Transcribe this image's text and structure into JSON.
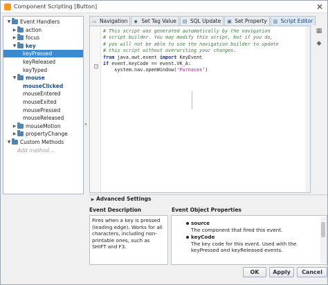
{
  "window": {
    "title": "Component Scripting [Button]"
  },
  "tree": {
    "items": [
      {
        "label": "Event Handlers",
        "level": 0,
        "expanded": true,
        "folder": true
      },
      {
        "label": "action",
        "level": 1,
        "expanded": false,
        "folder": true
      },
      {
        "label": "focus",
        "level": 1,
        "expanded": false,
        "folder": true
      },
      {
        "label": "key",
        "level": 1,
        "expanded": true,
        "folder": true,
        "bold": true
      },
      {
        "label": "keyPressed",
        "level": 2,
        "selected": true
      },
      {
        "label": "keyReleased",
        "level": 2
      },
      {
        "label": "keyTyped",
        "level": 2
      },
      {
        "label": "mouse",
        "level": 1,
        "expanded": true,
        "folder": true,
        "bold": true
      },
      {
        "label": "mouseClicked",
        "level": 2,
        "bold": true
      },
      {
        "label": "mouseEntered",
        "level": 2
      },
      {
        "label": "mouseExited",
        "level": 2
      },
      {
        "label": "mousePressed",
        "level": 2
      },
      {
        "label": "mouseReleased",
        "level": 2
      },
      {
        "label": "mouseMotion",
        "level": 1,
        "expanded": false,
        "folder": true
      },
      {
        "label": "propertyChange",
        "level": 1,
        "expanded": false,
        "folder": true
      },
      {
        "label": "Custom Methods",
        "level": 0,
        "expanded": true,
        "folder": true
      },
      {
        "label": "Add method...",
        "level": 1,
        "placeholder": true
      }
    ]
  },
  "tabs": [
    {
      "label": "Navigation",
      "icon": "navigation-icon",
      "active": false
    },
    {
      "label": "Set Tag Value",
      "icon": "tag-icon",
      "active": false
    },
    {
      "label": "SQL Update",
      "icon": "database-icon",
      "active": false
    },
    {
      "label": "Set Property",
      "icon": "property-icon",
      "active": false
    },
    {
      "label": "Script Editor",
      "icon": "script-icon",
      "active": true
    }
  ],
  "editor": {
    "lines": [
      {
        "text": "# This script was generated automatically by the navigation",
        "kind": "comment"
      },
      {
        "text": "# script builder. You may modify this script, but if you do,",
        "kind": "comment"
      },
      {
        "text": "# you will not be able to use the navigation builder to update",
        "kind": "comment"
      },
      {
        "text": "# this script without overwriting your changes.",
        "kind": "comment"
      },
      {
        "text": "from java.awt.event import KeyEvent",
        "kind": "import"
      },
      {
        "text": "if event.keyCode == event.VK_A:",
        "kind": "if"
      },
      {
        "text": "\tsystem.nav.openWindow('Furnaces')",
        "kind": "call"
      }
    ]
  },
  "advanced": {
    "label": "Advanced Settings"
  },
  "event_description": {
    "heading": "Event Description",
    "text": "Fires when a key is pressed (leading edge). Works for all characters, including non-printable ones, such as SHIFT and F3."
  },
  "event_properties": {
    "heading": "Event Object Properties",
    "items": [
      {
        "name": "source",
        "desc": "The component that fired this event."
      },
      {
        "name": "keyCode",
        "desc": "The key code for this event. Used with the keyPressed and keyReleased events."
      }
    ]
  },
  "buttons": {
    "ok": "OK",
    "apply": "Apply",
    "cancel": "Cancel"
  },
  "colors": {
    "selection": "#3b8ad0",
    "comment": "#3f7f3f",
    "keyword": "#1f2c8a",
    "string": "#a11d8a"
  }
}
